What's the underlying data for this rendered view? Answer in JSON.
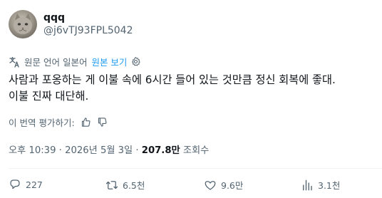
{
  "author": {
    "display_name": "qqq",
    "handle": "@j6vTJ93FPL5042",
    "avatar_icon": "cat-avatar"
  },
  "translation": {
    "source_label": "원문 언어 일본어",
    "show_original_label": "원본 보기",
    "settings_icon": "gear-icon"
  },
  "post": {
    "line1": "사람과 포옹하는 게 이불 속에 6시간 들어 있는 것만큼 정신 회복에 좋대.",
    "line2": "이불 진짜 대단해."
  },
  "rate": {
    "label": "이 번역 평가하기:"
  },
  "meta": {
    "time": "오후 10:39",
    "date": "2026년 5월 3일",
    "views_count": "207.8만",
    "views_label": "조회수"
  },
  "actions": {
    "replies": "227",
    "reposts": "6.5천",
    "likes": "9.6만",
    "views": "3.1천"
  },
  "colors": {
    "text": "#0f1419",
    "secondary": "#536471",
    "accent": "#1d9bf0",
    "divider": "#eff3f4"
  }
}
